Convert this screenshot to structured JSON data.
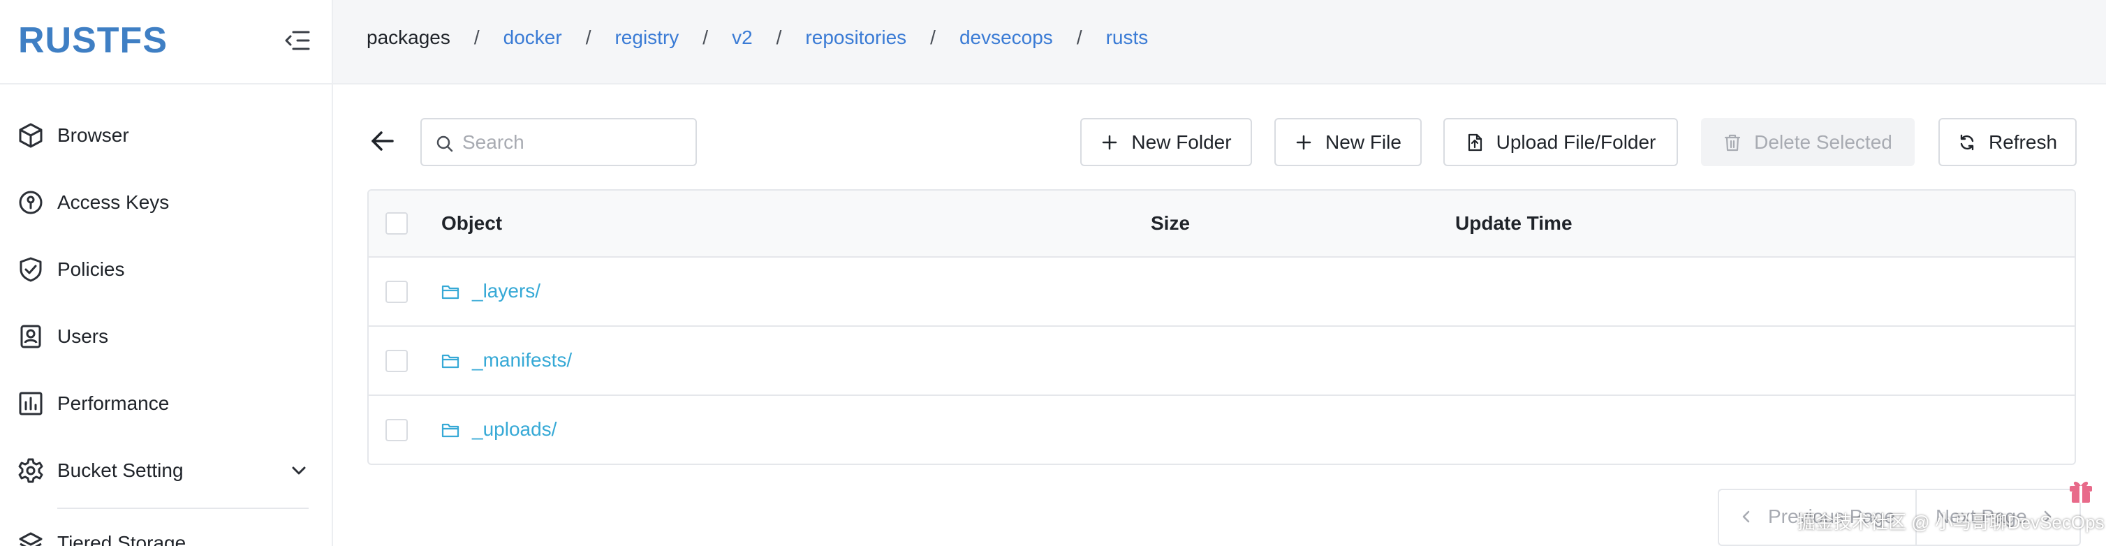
{
  "app": {
    "logo": "RUSTFS"
  },
  "sidebar": {
    "items": [
      {
        "label": "Browser",
        "icon": "cube-icon"
      },
      {
        "label": "Access Keys",
        "icon": "key-icon"
      },
      {
        "label": "Policies",
        "icon": "shield-check-icon"
      },
      {
        "label": "Users",
        "icon": "user-badge-icon"
      },
      {
        "label": "Performance",
        "icon": "chart-icon"
      },
      {
        "label": "Bucket Setting",
        "icon": "gear-icon",
        "expandable": true
      },
      {
        "label": "Tiered Storage",
        "icon": "layers-icon"
      }
    ]
  },
  "breadcrumb": [
    "packages",
    "docker",
    "registry",
    "v2",
    "repositories",
    "devsecops",
    "rusts"
  ],
  "toolbar": {
    "search_placeholder": "Search",
    "new_folder": "New Folder",
    "new_file": "New File",
    "upload": "Upload File/Folder",
    "delete_selected": "Delete Selected",
    "refresh": "Refresh"
  },
  "table": {
    "columns": [
      "Object",
      "Size",
      "Update Time"
    ],
    "rows": [
      {
        "name": "_layers/",
        "size": "",
        "update_time": ""
      },
      {
        "name": "_manifests/",
        "size": "",
        "update_time": ""
      },
      {
        "name": "_uploads/",
        "size": "",
        "update_time": ""
      }
    ]
  },
  "pagination": {
    "previous": "Previous Page",
    "next": "Next Page"
  },
  "watermark": "掘金技术社区 @ 小马哥聊DevSecOps",
  "colors": {
    "brand": "#3f7fc4",
    "link": "#3a7bd5",
    "folder": "#36a9d6"
  }
}
